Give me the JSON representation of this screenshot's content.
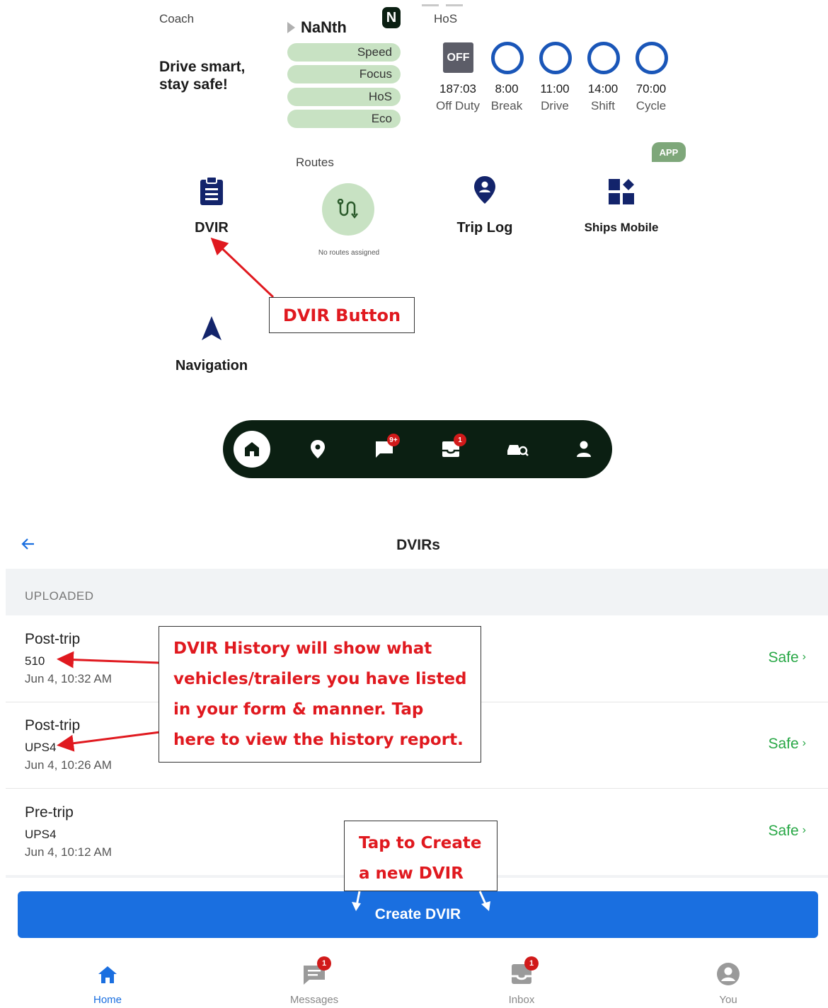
{
  "coach": {
    "label": "Coach",
    "tagline_line1": "Drive smart,",
    "tagline_line2": "stay safe!",
    "driver_name": "NaNth",
    "logo_letter": "N",
    "categories": [
      "Speed",
      "Focus",
      "HoS",
      "Eco"
    ]
  },
  "hos": {
    "label": "HoS",
    "status_badge": "OFF",
    "items": [
      {
        "value": "187:03",
        "caption": "Off Duty"
      },
      {
        "value": "8:00",
        "caption": "Break"
      },
      {
        "value": "11:00",
        "caption": "Drive"
      },
      {
        "value": "14:00",
        "caption": "Shift"
      },
      {
        "value": "70:00",
        "caption": "Cycle"
      }
    ]
  },
  "tiles": {
    "dvir": "DVIR",
    "routes_label": "Routes",
    "no_routes": "No routes assigned",
    "trip_log": "Trip Log",
    "ships_mobile": "Ships Mobile",
    "app_badge": "APP",
    "navigation": "Navigation"
  },
  "dock": {
    "messages_badge": "9+",
    "inbox_badge": "1"
  },
  "annotations": {
    "dvir_button": "DVIR Button",
    "history_line1": "DVIR History will show what",
    "history_line2": "vehicles/trailers you have listed",
    "history_line3": "in your form & manner. Tap",
    "history_line4": "here to view the history report.",
    "create_line1": "Tap to Create",
    "create_line2": "a new DVIR"
  },
  "dvirs": {
    "title": "DVIRs",
    "section": "UPLOADED",
    "rows": [
      {
        "type": "Post-trip",
        "vehicle": "510",
        "date": "Jun 4, 10:32 AM",
        "status": "Safe"
      },
      {
        "type": "Post-trip",
        "vehicle": "UPS4",
        "date": "Jun 4, 10:26 AM",
        "status": "Safe"
      },
      {
        "type": "Pre-trip",
        "vehicle": "UPS4",
        "date": "Jun 4, 10:12 AM",
        "status": "Safe"
      }
    ],
    "create_button": "Create DVIR"
  },
  "bottom_nav": {
    "items": [
      {
        "label": "Home"
      },
      {
        "label": "Messages",
        "badge": "1"
      },
      {
        "label": "Inbox",
        "badge": "1"
      },
      {
        "label": "You"
      }
    ]
  },
  "colors": {
    "accent_blue": "#1a6fe0",
    "hos_ring": "#1a56b8",
    "safe_green": "#27a745",
    "score_pill": "#c8e2c3",
    "annotation_red": "#e0191f",
    "dock_dark": "#0b1f12",
    "badge_red": "#d11a1a"
  }
}
